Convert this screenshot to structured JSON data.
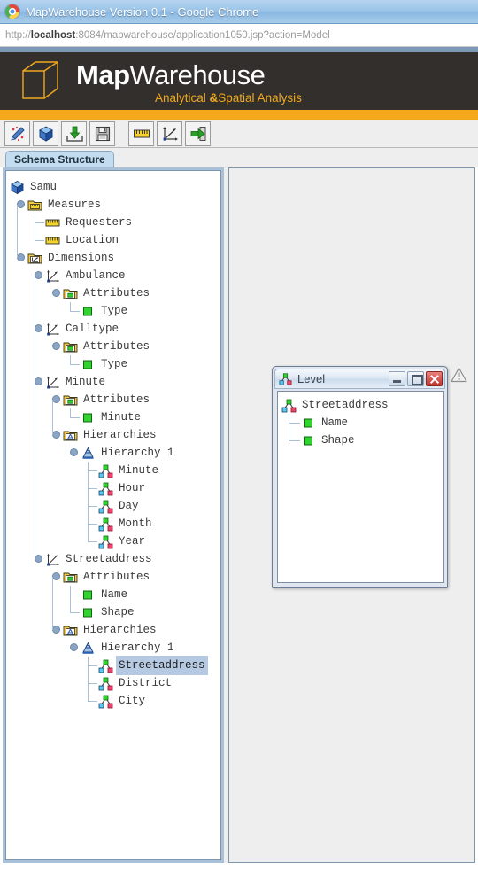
{
  "browser": {
    "title": "MapWarehouse Version 0.1 - Google Chrome",
    "url_prefix": "http://",
    "url_host": "localhost",
    "url_rest": ":8084/mapwarehouse/application1050.jsp?action=Model",
    "chrome_logo_icon": "chrome-logo-icon"
  },
  "brand": {
    "name_bold": "Map",
    "name_regular": "Warehouse",
    "tagline_part1": "Analytical ",
    "tagline_amp": "&",
    "tagline_part2": "Spatial Analysis",
    "logo_icon": "wireframe-cube-icon",
    "dark_bg": "#332f2c",
    "accent": "#f5a81c"
  },
  "toolbar": {
    "buttons": [
      {
        "name": "map-tool-button",
        "icon": "map-pin-arrow-icon"
      },
      {
        "name": "cube-button",
        "icon": "blue-cube-icon"
      },
      {
        "name": "import-button",
        "icon": "download-tray-icon"
      },
      {
        "name": "save-button",
        "icon": "floppy-disk-icon"
      },
      {
        "name": "measure-button",
        "icon": "ruler-icon"
      },
      {
        "name": "dimension-button",
        "icon": "axes-arrow-icon"
      },
      {
        "name": "exit-button",
        "icon": "exit-door-arrow-icon"
      }
    ]
  },
  "tabs": [
    {
      "label": "Schema Structure",
      "selected": true
    }
  ],
  "tree": {
    "nodes": [
      {
        "label": "Samu",
        "depth": 0,
        "icon": "blue-cube-icon",
        "knob": false,
        "elbow": false,
        "sel": false
      },
      {
        "label": "Measures",
        "depth": 1,
        "icon": "measures-folder-icon",
        "knob": true,
        "elbow": false,
        "sel": false
      },
      {
        "label": "Requesters",
        "depth": 2,
        "icon": "ruler-icon",
        "knob": false,
        "elbow": "tee",
        "sel": false
      },
      {
        "label": "Location",
        "depth": 2,
        "icon": "ruler-icon",
        "knob": false,
        "elbow": "last",
        "sel": false
      },
      {
        "label": "Dimensions",
        "depth": 1,
        "icon": "dimensions-folder-icon",
        "knob": true,
        "elbow": false,
        "sel": false
      },
      {
        "label": "Ambulance",
        "depth": 2,
        "icon": "axes-icon",
        "knob": true,
        "elbow": false,
        "sel": false
      },
      {
        "label": "Attributes",
        "depth": 3,
        "icon": "attributes-folder-icon",
        "knob": true,
        "elbow": false,
        "sel": false
      },
      {
        "label": "Type",
        "depth": 4,
        "icon": "green-square-icon",
        "knob": false,
        "elbow": "last",
        "sel": false
      },
      {
        "label": "Calltype",
        "depth": 2,
        "icon": "axes-icon",
        "knob": true,
        "elbow": false,
        "sel": false
      },
      {
        "label": "Attributes",
        "depth": 3,
        "icon": "attributes-folder-icon",
        "knob": true,
        "elbow": false,
        "sel": false
      },
      {
        "label": "Type",
        "depth": 4,
        "icon": "green-square-icon",
        "knob": false,
        "elbow": "last",
        "sel": false
      },
      {
        "label": "Minute",
        "depth": 2,
        "icon": "axes-icon",
        "knob": true,
        "elbow": false,
        "sel": false
      },
      {
        "label": "Attributes",
        "depth": 3,
        "icon": "attributes-folder-icon",
        "knob": true,
        "elbow": false,
        "sel": false
      },
      {
        "label": "Minute",
        "depth": 4,
        "icon": "green-square-icon",
        "knob": false,
        "elbow": "last",
        "sel": false
      },
      {
        "label": "Hierarchies",
        "depth": 3,
        "icon": "hierarchies-folder-icon",
        "knob": true,
        "elbow": false,
        "sel": false
      },
      {
        "label": "Hierarchy 1",
        "depth": 4,
        "icon": "pyramid-icon",
        "knob": true,
        "elbow": false,
        "sel": false
      },
      {
        "label": "Minute",
        "depth": 5,
        "icon": "level-icon",
        "knob": false,
        "elbow": "tee",
        "sel": false
      },
      {
        "label": "Hour",
        "depth": 5,
        "icon": "level-icon",
        "knob": false,
        "elbow": "tee",
        "sel": false
      },
      {
        "label": "Day",
        "depth": 5,
        "icon": "level-icon",
        "knob": false,
        "elbow": "tee",
        "sel": false
      },
      {
        "label": "Month",
        "depth": 5,
        "icon": "level-icon",
        "knob": false,
        "elbow": "tee",
        "sel": false
      },
      {
        "label": "Year",
        "depth": 5,
        "icon": "level-icon",
        "knob": false,
        "elbow": "last",
        "sel": false
      },
      {
        "label": "Streetaddress",
        "depth": 2,
        "icon": "axes-icon",
        "knob": true,
        "elbow": false,
        "sel": false
      },
      {
        "label": "Attributes",
        "depth": 3,
        "icon": "attributes-folder-icon",
        "knob": true,
        "elbow": false,
        "sel": false
      },
      {
        "label": "Name",
        "depth": 4,
        "icon": "green-square-icon",
        "knob": false,
        "elbow": "tee",
        "sel": false
      },
      {
        "label": "Shape",
        "depth": 4,
        "icon": "green-square-icon",
        "knob": false,
        "elbow": "last",
        "sel": false
      },
      {
        "label": "Hierarchies",
        "depth": 3,
        "icon": "hierarchies-folder-icon",
        "knob": true,
        "elbow": false,
        "sel": false
      },
      {
        "label": "Hierarchy 1",
        "depth": 4,
        "icon": "pyramid-icon",
        "knob": true,
        "elbow": false,
        "sel": false
      },
      {
        "label": "Streetaddress",
        "depth": 5,
        "icon": "level-icon",
        "knob": false,
        "elbow": "tee",
        "sel": true
      },
      {
        "label": "District",
        "depth": 5,
        "icon": "level-icon",
        "knob": false,
        "elbow": "tee",
        "sel": false
      },
      {
        "label": "City",
        "depth": 5,
        "icon": "level-icon",
        "knob": false,
        "elbow": "last",
        "sel": false
      }
    ]
  },
  "dialog": {
    "title": "Level",
    "title_icon": "level-icon",
    "minimize_label": "minimize",
    "maximize_label": "maximize",
    "close_label": "close",
    "nodes": [
      {
        "label": "Streetaddress",
        "depth": 0,
        "icon": "level-icon",
        "elbow": false,
        "sel": false
      },
      {
        "label": "Name",
        "depth": 1,
        "icon": "green-square-icon",
        "elbow": "tee",
        "sel": false
      },
      {
        "label": "Shape",
        "depth": 1,
        "icon": "green-square-icon",
        "elbow": "last",
        "sel": false
      }
    ]
  },
  "warning": {
    "icon": "warning-triangle-icon"
  }
}
